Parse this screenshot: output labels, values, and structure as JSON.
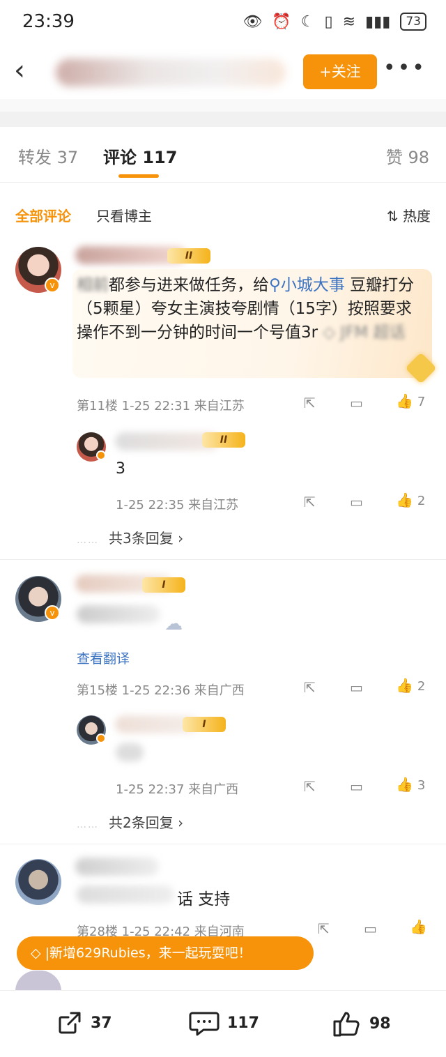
{
  "status_bar": {
    "time": "23:39",
    "battery": "73"
  },
  "nav": {
    "follow_label": "+关注",
    "more_label": "•••"
  },
  "tabs": [
    {
      "label": "转发 37"
    },
    {
      "label": "评论 117"
    },
    {
      "label": "赞 98"
    }
  ],
  "filter": {
    "all": "全部评论",
    "author_only": "只看博主",
    "sort": "热度"
  },
  "comments": [
    {
      "level": "II",
      "text_before_link": "都参与进来做任务，给",
      "link": "小城大事",
      "text_after_link": "豆瓣打分（5颗星）夸女主演技夸剧情（15字）按照要求操作不到一分钟的时间一个号值3r",
      "meta": "第11楼  1-25 22:31  来自江苏",
      "likes": "7",
      "reply": {
        "level": "II",
        "text": "3",
        "meta": "1-25 22:35  来自江苏",
        "likes": "2"
      },
      "more_replies": "共3条回复 ›"
    },
    {
      "level": "I",
      "translate": "查看翻译",
      "meta": "第15楼  1-25 22:36  来自广西",
      "likes": "2",
      "reply": {
        "level": "I",
        "meta": "1-25 22:37  来自广西",
        "likes": "3"
      },
      "more_replies": "共2条回复 ›"
    },
    {
      "text": "话  支持",
      "meta": "第28楼  1-25 22:42  来自河南"
    }
  ],
  "toast": "|新增629Rubies，来一起玩耍吧！",
  "bottom_bar": {
    "reposts": "37",
    "comments": "117",
    "likes": "98"
  }
}
